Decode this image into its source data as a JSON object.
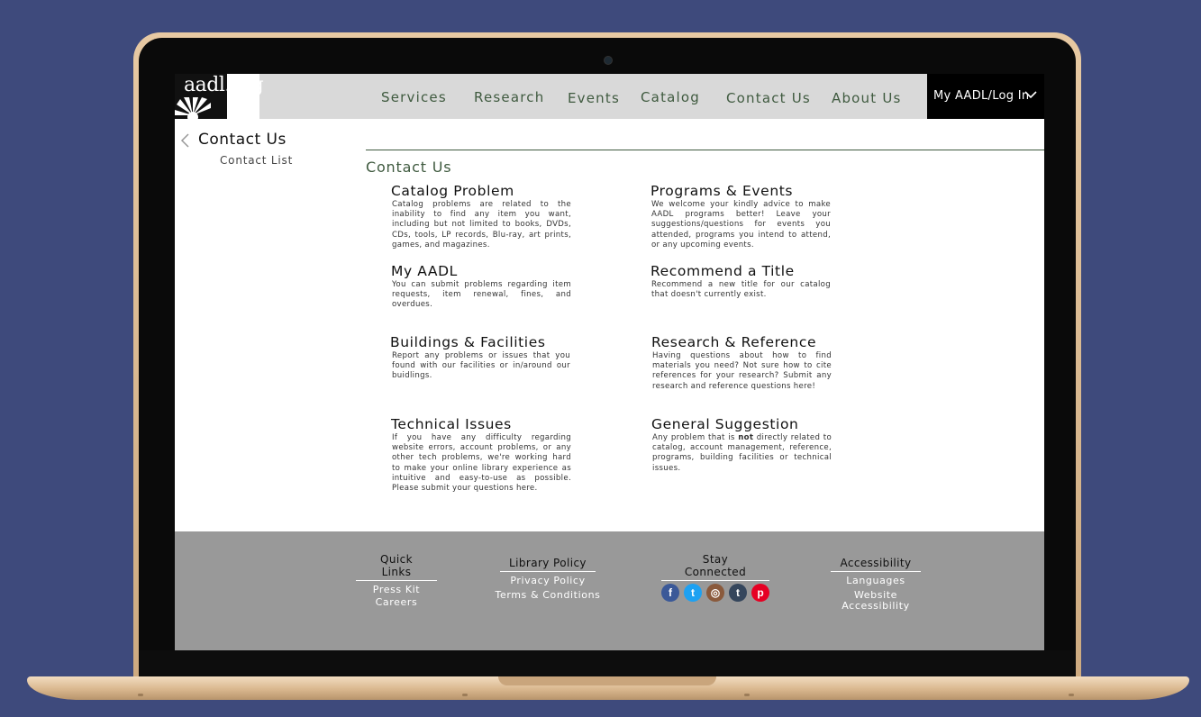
{
  "header": {
    "logo_text": "aadl.org",
    "nav": [
      "Services",
      "Research",
      "Events",
      "Catalog",
      "Contact Us",
      "About Us"
    ],
    "login_label": "My AADL/Log In"
  },
  "sidebar": {
    "title": "Contact Us",
    "items": [
      "Contact List"
    ]
  },
  "main": {
    "title": "Contact Us",
    "cards": [
      {
        "title": "Catalog Problem",
        "text": "Catalog problems are related to the inability to find any item you want, including but not limited to books, DVDs, CDs, tools, LP records, Blu-ray, art prints, games, and magazines."
      },
      {
        "title": "Programs & Events",
        "text": "We welcome your kindly advice to make AADL programs better! Leave your suggestions/questions for events you attended, programs you intend to attend, or any upcoming events."
      },
      {
        "title": "My AADL",
        "text": "You can submit problems regarding item requests, item renewal, fines, and overdues."
      },
      {
        "title": "Recommend a Title",
        "text": "Recommend a new title for our catalog that doesn't currently exist."
      },
      {
        "title": "Buildings & Facilities",
        "text": "Report any problems or issues that you found with our facilities or in/around our buidlings."
      },
      {
        "title": "Research & Reference",
        "text": "Having questions about how to find materials you need? Not sure how to cite references for your research? Submit any research and reference questions here!"
      },
      {
        "title": "Technical Issues",
        "text": "If you have any difficulty regarding website errors, account problems, or any other tech problems, we're working hard to make your online library experience as intuitive and easy-to-use as possible. Please submit your questions here."
      },
      {
        "title": "General Suggestion",
        "text_before": "Any problem that is ",
        "text_bold": "not",
        "text_after": " directly related to catalog, account management, reference, programs, building facilities or technical issues."
      }
    ]
  },
  "footer": {
    "quick_links": {
      "heading": "Quick Links",
      "links": [
        "Press Kit",
        "Careers"
      ]
    },
    "library_policy": {
      "heading": "Library Policy",
      "links": [
        "Privacy Policy",
        "Terms & Conditions"
      ]
    },
    "stay_connected": {
      "heading": "Stay Connected",
      "icons": [
        {
          "name": "facebook-icon",
          "glyph": "f",
          "color": "#3b5998"
        },
        {
          "name": "twitter-icon",
          "glyph": "t",
          "color": "#1da1f2"
        },
        {
          "name": "instagram-icon",
          "glyph": "◎",
          "color": "#8a5a3c"
        },
        {
          "name": "tumblr-icon",
          "glyph": "t",
          "color": "#35465c"
        },
        {
          "name": "pinterest-icon",
          "glyph": "p",
          "color": "#e60023"
        }
      ]
    },
    "accessibility": {
      "heading": "Accessibility",
      "links": [
        "Languages",
        "Website Accessibility"
      ]
    }
  },
  "colors": {
    "accent_green": "#3f5a3f",
    "nav_bg": "#d9d9d9",
    "footer_bg": "#999999",
    "page_bg": "#3e4a7c"
  }
}
